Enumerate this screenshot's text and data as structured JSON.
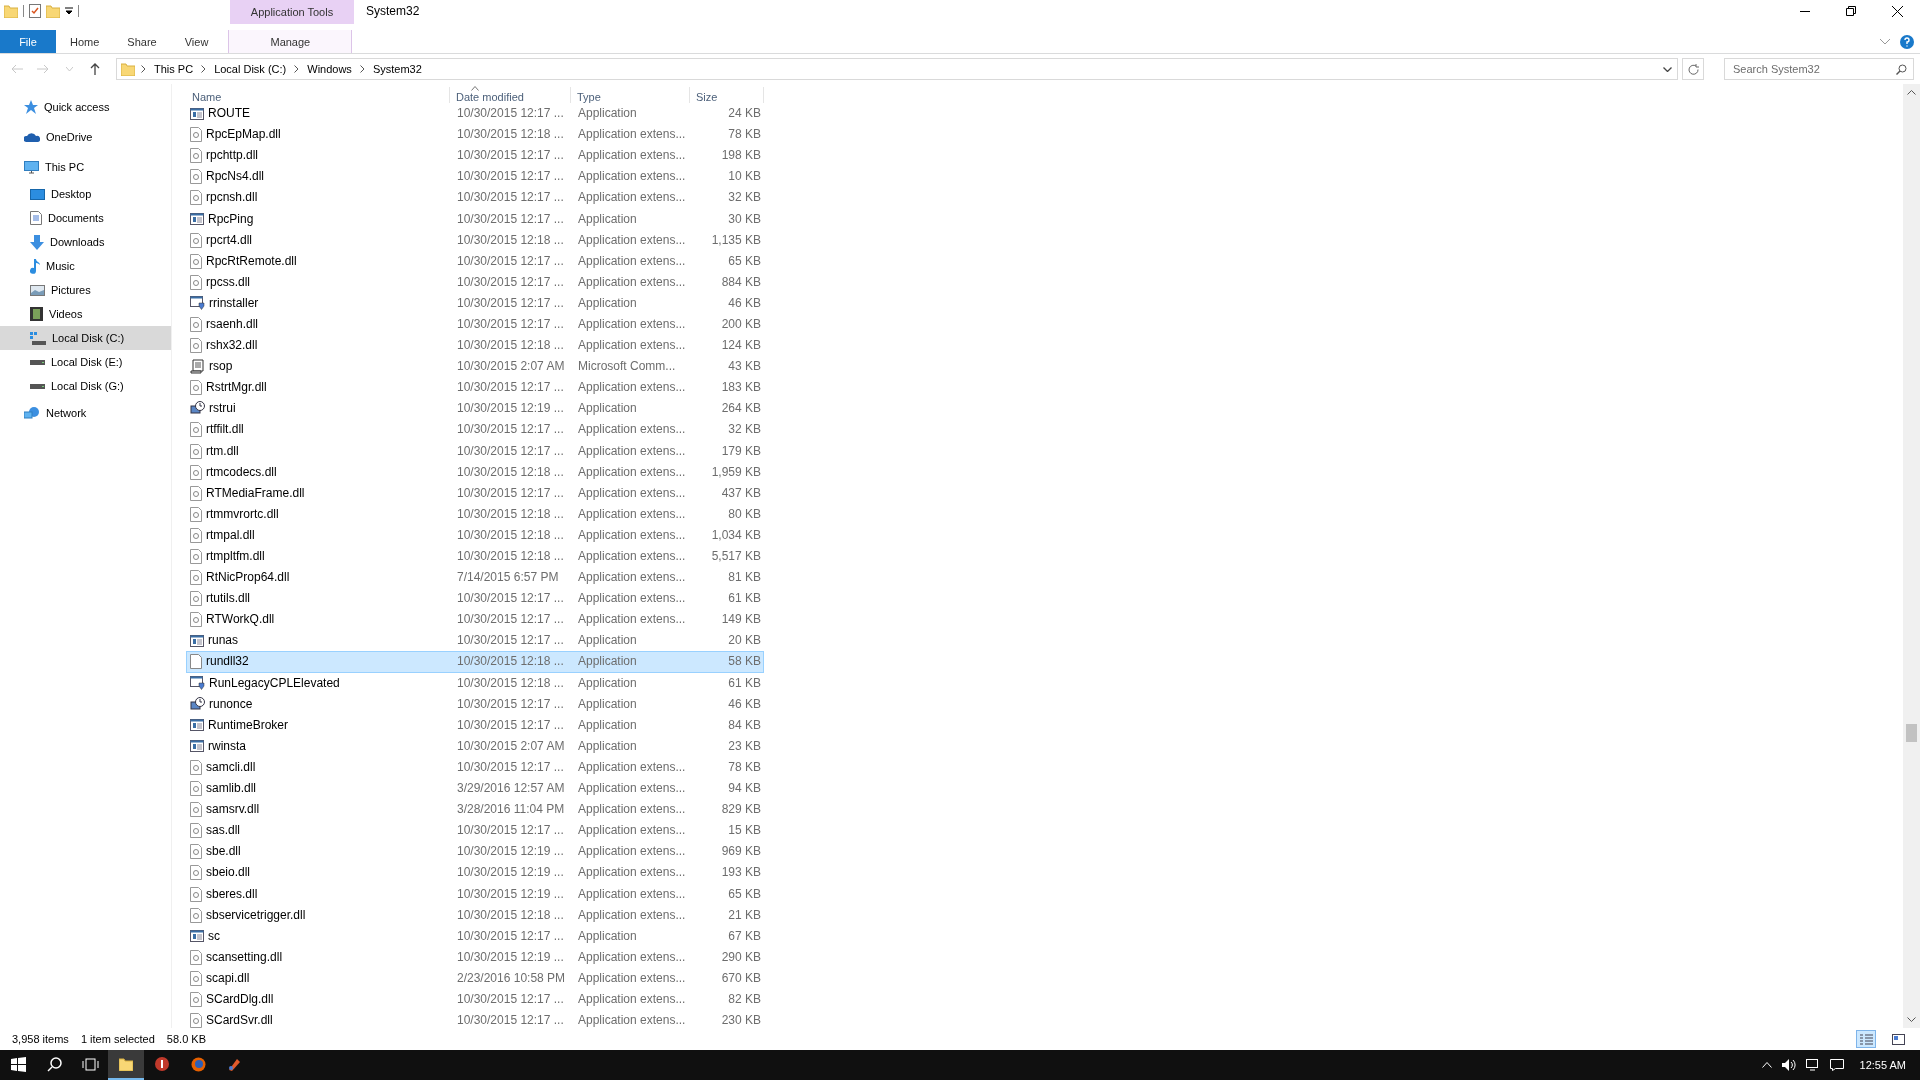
{
  "window": {
    "title": "System32",
    "context_group": "Application Tools"
  },
  "ribbon_tabs": [
    {
      "label": "File",
      "kind": "file",
      "selected": false
    },
    {
      "label": "Home",
      "kind": "tab",
      "selected": false
    },
    {
      "label": "Share",
      "kind": "tab",
      "selected": false
    },
    {
      "label": "View",
      "kind": "tab",
      "selected": false
    },
    {
      "label": "Manage",
      "kind": "context",
      "selected": false
    }
  ],
  "address": {
    "crumbs": [
      "This PC",
      "Local Disk (C:)",
      "Windows",
      "System32"
    ]
  },
  "search": {
    "placeholder": "Search System32"
  },
  "sidebar": {
    "items": [
      {
        "label": "Quick access",
        "kind": "star",
        "selected": false
      },
      {
        "label": "OneDrive",
        "kind": "cloud",
        "selected": false
      },
      {
        "label": "This PC",
        "kind": "pc",
        "selected": false,
        "children": [
          {
            "label": "Desktop",
            "kind": "desktop",
            "selected": false
          },
          {
            "label": "Documents",
            "kind": "document",
            "selected": false
          },
          {
            "label": "Downloads",
            "kind": "download",
            "selected": false
          },
          {
            "label": "Music",
            "kind": "music",
            "selected": false
          },
          {
            "label": "Pictures",
            "kind": "picture",
            "selected": false
          },
          {
            "label": "Videos",
            "kind": "video",
            "selected": false
          },
          {
            "label": "Local Disk (C:)",
            "kind": "sysdrive",
            "selected": true
          },
          {
            "label": "Local Disk (E:)",
            "kind": "drive",
            "selected": false
          },
          {
            "label": "Local Disk (G:)",
            "kind": "drive",
            "selected": false
          }
        ]
      },
      {
        "label": "Network",
        "kind": "network",
        "selected": false
      }
    ]
  },
  "table": {
    "columns": [
      "Name",
      "Date modified",
      "Type",
      "Size"
    ],
    "rows": [
      {
        "name": "ROUTE",
        "date": "10/30/2015 12:17 ...",
        "type": "Application",
        "size": "24 KB",
        "kind": "window",
        "selected": false
      },
      {
        "name": "RpcEpMap.dll",
        "date": "10/30/2015 12:18 ...",
        "type": "Application extens...",
        "size": "78 KB",
        "kind": "dll",
        "selected": false
      },
      {
        "name": "rpchttp.dll",
        "date": "10/30/2015 12:17 ...",
        "type": "Application extens...",
        "size": "198 KB",
        "kind": "dll",
        "selected": false
      },
      {
        "name": "RpcNs4.dll",
        "date": "10/30/2015 12:17 ...",
        "type": "Application extens...",
        "size": "10 KB",
        "kind": "dll",
        "selected": false
      },
      {
        "name": "rpcnsh.dll",
        "date": "10/30/2015 12:17 ...",
        "type": "Application extens...",
        "size": "32 KB",
        "kind": "dll",
        "selected": false
      },
      {
        "name": "RpcPing",
        "date": "10/30/2015 12:17 ...",
        "type": "Application",
        "size": "30 KB",
        "kind": "window",
        "selected": false
      },
      {
        "name": "rpcrt4.dll",
        "date": "10/30/2015 12:18 ...",
        "type": "Application extens...",
        "size": "1,135 KB",
        "kind": "dll",
        "selected": false
      },
      {
        "name": "RpcRtRemote.dll",
        "date": "10/30/2015 12:17 ...",
        "type": "Application extens...",
        "size": "65 KB",
        "kind": "dll",
        "selected": false
      },
      {
        "name": "rpcss.dll",
        "date": "10/30/2015 12:17 ...",
        "type": "Application extens...",
        "size": "884 KB",
        "kind": "dll",
        "selected": false
      },
      {
        "name": "rrinstaller",
        "date": "10/30/2015 12:17 ...",
        "type": "Application",
        "size": "46 KB",
        "kind": "shield",
        "selected": false
      },
      {
        "name": "rsaenh.dll",
        "date": "10/30/2015 12:17 ...",
        "type": "Application extens...",
        "size": "200 KB",
        "kind": "dll",
        "selected": false
      },
      {
        "name": "rshx32.dll",
        "date": "10/30/2015 12:18 ...",
        "type": "Application extens...",
        "size": "124 KB",
        "kind": "dll",
        "selected": false
      },
      {
        "name": "rsop",
        "date": "10/30/2015 2:07 AM",
        "type": "Microsoft Comm...",
        "size": "43 KB",
        "kind": "scroll",
        "selected": false
      },
      {
        "name": "RstrtMgr.dll",
        "date": "10/30/2015 12:17 ...",
        "type": "Application extens...",
        "size": "183 KB",
        "kind": "dll",
        "selected": false
      },
      {
        "name": "rstrui",
        "date": "10/30/2015 12:19 ...",
        "type": "Application",
        "size": "264 KB",
        "kind": "restore",
        "selected": false
      },
      {
        "name": "rtffilt.dll",
        "date": "10/30/2015 12:17 ...",
        "type": "Application extens...",
        "size": "32 KB",
        "kind": "dll",
        "selected": false
      },
      {
        "name": "rtm.dll",
        "date": "10/30/2015 12:17 ...",
        "type": "Application extens...",
        "size": "179 KB",
        "kind": "dll",
        "selected": false
      },
      {
        "name": "rtmcodecs.dll",
        "date": "10/30/2015 12:18 ...",
        "type": "Application extens...",
        "size": "1,959 KB",
        "kind": "dll",
        "selected": false
      },
      {
        "name": "RTMediaFrame.dll",
        "date": "10/30/2015 12:17 ...",
        "type": "Application extens...",
        "size": "437 KB",
        "kind": "dll",
        "selected": false
      },
      {
        "name": "rtmmvrortc.dll",
        "date": "10/30/2015 12:18 ...",
        "type": "Application extens...",
        "size": "80 KB",
        "kind": "dll",
        "selected": false
      },
      {
        "name": "rtmpal.dll",
        "date": "10/30/2015 12:18 ...",
        "type": "Application extens...",
        "size": "1,034 KB",
        "kind": "dll",
        "selected": false
      },
      {
        "name": "rtmpltfm.dll",
        "date": "10/30/2015 12:18 ...",
        "type": "Application extens...",
        "size": "5,517 KB",
        "kind": "dll",
        "selected": false
      },
      {
        "name": "RtNicProp64.dll",
        "date": "7/14/2015 6:57 PM",
        "type": "Application extens...",
        "size": "81 KB",
        "kind": "dll",
        "selected": false
      },
      {
        "name": "rtutils.dll",
        "date": "10/30/2015 12:17 ...",
        "type": "Application extens...",
        "size": "61 KB",
        "kind": "dll",
        "selected": false
      },
      {
        "name": "RTWorkQ.dll",
        "date": "10/30/2015 12:17 ...",
        "type": "Application extens...",
        "size": "149 KB",
        "kind": "dll",
        "selected": false
      },
      {
        "name": "runas",
        "date": "10/30/2015 12:17 ...",
        "type": "Application",
        "size": "20 KB",
        "kind": "window",
        "selected": false
      },
      {
        "name": "rundll32",
        "date": "10/30/2015 12:18 ...",
        "type": "Application",
        "size": "58 KB",
        "kind": "blank",
        "selected": true
      },
      {
        "name": "RunLegacyCPLElevated",
        "date": "10/30/2015 12:18 ...",
        "type": "Application",
        "size": "61 KB",
        "kind": "shield",
        "selected": false
      },
      {
        "name": "runonce",
        "date": "10/30/2015 12:17 ...",
        "type": "Application",
        "size": "46 KB",
        "kind": "restore",
        "selected": false
      },
      {
        "name": "RuntimeBroker",
        "date": "10/30/2015 12:17 ...",
        "type": "Application",
        "size": "84 KB",
        "kind": "window",
        "selected": false
      },
      {
        "name": "rwinsta",
        "date": "10/30/2015 2:07 AM",
        "type": "Application",
        "size": "23 KB",
        "kind": "window",
        "selected": false
      },
      {
        "name": "samcli.dll",
        "date": "10/30/2015 12:17 ...",
        "type": "Application extens...",
        "size": "78 KB",
        "kind": "dll",
        "selected": false
      },
      {
        "name": "samlib.dll",
        "date": "3/29/2016 12:57 AM",
        "type": "Application extens...",
        "size": "94 KB",
        "kind": "dll",
        "selected": false
      },
      {
        "name": "samsrv.dll",
        "date": "3/28/2016 11:04 PM",
        "type": "Application extens...",
        "size": "829 KB",
        "kind": "dll",
        "selected": false
      },
      {
        "name": "sas.dll",
        "date": "10/30/2015 12:17 ...",
        "type": "Application extens...",
        "size": "15 KB",
        "kind": "dll",
        "selected": false
      },
      {
        "name": "sbe.dll",
        "date": "10/30/2015 12:19 ...",
        "type": "Application extens...",
        "size": "969 KB",
        "kind": "dll",
        "selected": false
      },
      {
        "name": "sbeio.dll",
        "date": "10/30/2015 12:19 ...",
        "type": "Application extens...",
        "size": "193 KB",
        "kind": "dll",
        "selected": false
      },
      {
        "name": "sberes.dll",
        "date": "10/30/2015 12:19 ...",
        "type": "Application extens...",
        "size": "65 KB",
        "kind": "dll",
        "selected": false
      },
      {
        "name": "sbservicetrigger.dll",
        "date": "10/30/2015 12:18 ...",
        "type": "Application extens...",
        "size": "21 KB",
        "kind": "dll",
        "selected": false
      },
      {
        "name": "sc",
        "date": "10/30/2015 12:17 ...",
        "type": "Application",
        "size": "67 KB",
        "kind": "window",
        "selected": false
      },
      {
        "name": "scansetting.dll",
        "date": "10/30/2015 12:19 ...",
        "type": "Application extens...",
        "size": "290 KB",
        "kind": "dll",
        "selected": false
      },
      {
        "name": "scapi.dll",
        "date": "2/23/2016 10:58 PM",
        "type": "Application extens...",
        "size": "670 KB",
        "kind": "dll",
        "selected": false
      },
      {
        "name": "SCardDlg.dll",
        "date": "10/30/2015 12:17 ...",
        "type": "Application extens...",
        "size": "82 KB",
        "kind": "dll",
        "selected": false
      },
      {
        "name": "SCardSvr.dll",
        "date": "10/30/2015 12:17 ...",
        "type": "Application extens...",
        "size": "230 KB",
        "kind": "dll",
        "selected": false
      }
    ]
  },
  "status_bar": {
    "items": [
      "3,958 items",
      "1 item selected",
      "58.0 KB"
    ],
    "views": [
      {
        "kind": "details",
        "selected": true
      },
      {
        "kind": "tiles",
        "selected": false
      }
    ]
  },
  "taskbar": {
    "apps": [
      {
        "kind": "start",
        "selected": false
      },
      {
        "kind": "search",
        "selected": false
      },
      {
        "kind": "taskview",
        "selected": false
      },
      {
        "kind": "explorer",
        "selected": true
      },
      {
        "kind": "redapp",
        "selected": false
      },
      {
        "kind": "browser",
        "selected": false
      },
      {
        "kind": "tool",
        "selected": false
      }
    ],
    "clock": "12:55 AM"
  }
}
